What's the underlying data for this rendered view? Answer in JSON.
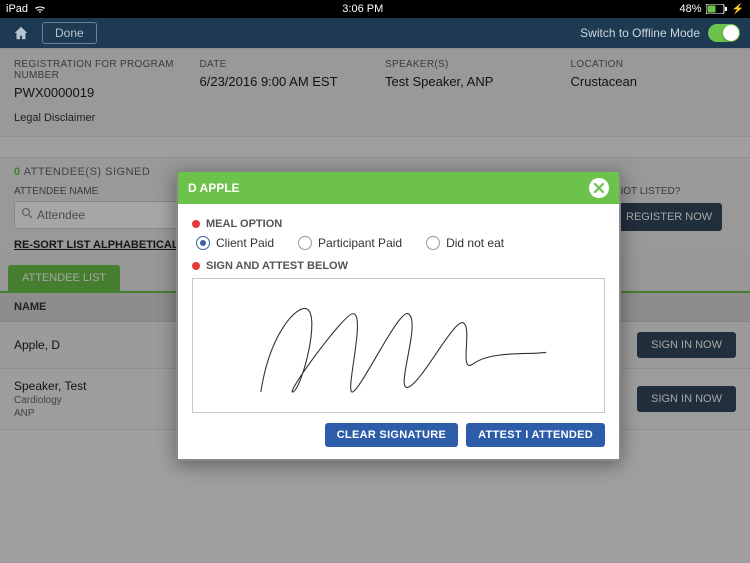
{
  "status": {
    "device": "iPad",
    "time": "3:06 PM",
    "battery": "48%"
  },
  "nav": {
    "done": "Done",
    "offline_label": "Switch to Offline Mode",
    "offline_on": true
  },
  "info": {
    "reg_label": "REGISTRATION FOR PROGRAM NUMBER",
    "reg_value": "PWX0000019",
    "date_label": "DATE",
    "date_value": "6/23/2016 9:00 AM EST",
    "speaker_label": "SPEAKER(S)",
    "speaker_value": "Test Speaker, ANP",
    "location_label": "LOCATION",
    "location_value": "Crustacean",
    "legal": "Legal Disclaimer"
  },
  "attendees": {
    "signed_count": "0",
    "signed_label": " ATTENDEE(S) SIGNED",
    "name_label": "ATTENDEE NAME",
    "search_placeholder": "Attendee",
    "resort": "RE-SORT LIST ALPHABETICALLY",
    "not_listed": "NOT LISTED?",
    "register_btn": "REGISTER NOW",
    "tab": "ATTENDEE LIST",
    "col_name": "NAME",
    "signin_btn": "SIGN IN NOW",
    "rows": [
      {
        "name": "Apple, D"
      },
      {
        "name": "Speaker, Test",
        "specialty": "Cardiology",
        "credential": "ANP"
      }
    ]
  },
  "modal": {
    "title": "D APPLE",
    "meal_label": "MEAL OPTION",
    "meal_options": [
      "Client Paid",
      "Participant Paid",
      "Did not eat"
    ],
    "meal_selected": "Client Paid",
    "sign_label": "SIGN AND ATTEST BELOW",
    "clear_btn": "CLEAR SIGNATURE",
    "attest_btn": "ATTEST I ATTENDED"
  },
  "colors": {
    "accent_green": "#6cc24a",
    "button_dark": "#33475b",
    "button_blue": "#2d5da8",
    "required_red": "#e53935"
  }
}
